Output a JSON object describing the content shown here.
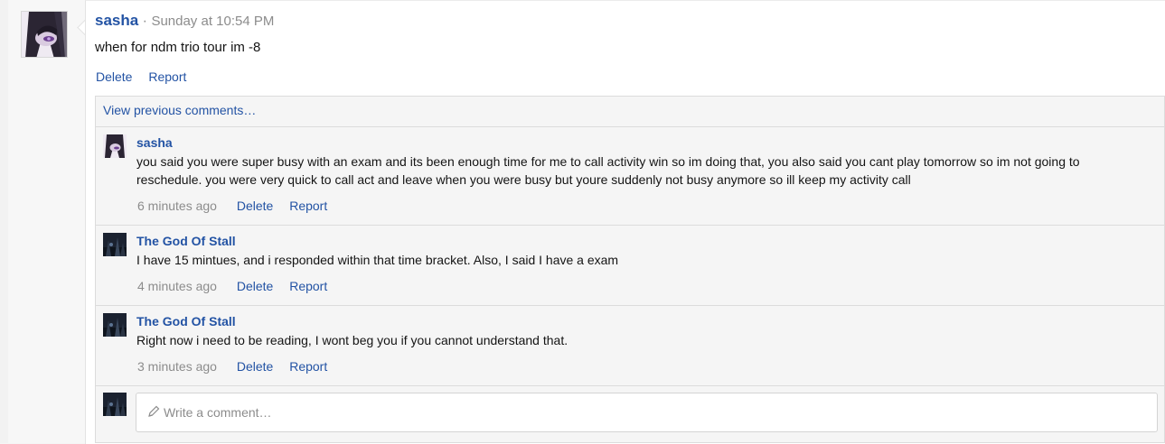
{
  "post": {
    "author": "sasha",
    "separator": "·",
    "time": "Sunday at 10:54 PM",
    "body": "when for ndm trio tour im -8",
    "actions": {
      "delete": "Delete",
      "report": "Report"
    }
  },
  "comments": {
    "view_previous": "View previous comments…",
    "items": [
      {
        "author": "sasha",
        "text": "you said you were super busy with an exam and its been enough time for me to call activity win so im doing that, you also said you cant play tomorrow so im not going to reschedule. you were very quick to call act and leave when you were busy but youre suddenly not busy anymore so ill keep my activity call",
        "age": "6 minutes ago",
        "delete": "Delete",
        "report": "Report"
      },
      {
        "author": "The God Of Stall",
        "text": "I have 15 mintues, and i responded within that time bracket. Also, I said I have a exam",
        "age": "4 minutes ago",
        "delete": "Delete",
        "report": "Report"
      },
      {
        "author": "The God Of Stall",
        "text": "Right now i need to be reading, I wont beg you if you cannot understand that.",
        "age": "3 minutes ago",
        "delete": "Delete",
        "report": "Report"
      }
    ],
    "composer": {
      "placeholder": "Write a comment…",
      "icon": "pencil-icon"
    }
  },
  "colors": {
    "link": "#2353a4",
    "muted": "#8c8c8c",
    "panel": "#f5f5f5"
  }
}
